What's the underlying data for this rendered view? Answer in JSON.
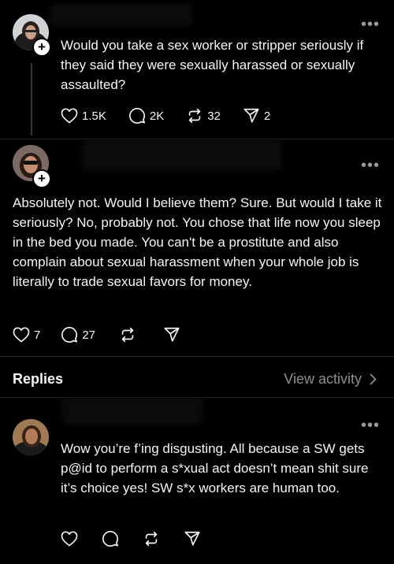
{
  "post": {
    "text": "Would you take a sex worker or stripper seriously if they said they were sexually harassed or sexually assaulted?",
    "likes": "1.5K",
    "comments": "2K",
    "reposts": "32",
    "shares": "2",
    "more": "•••"
  },
  "comment": {
    "text": "Absolutely not. Would I believe them? Sure. But would I take it seriously? No, probably not. You chose that life now you sleep in the bed you made.  You can't be a prostitute and also complain about sexual harassment when your whole job is literally to trade sexual favors for money.",
    "likes": "7",
    "comments": "27",
    "more": "•••"
  },
  "replies_header": {
    "title": "Replies",
    "view_activity": "View activity"
  },
  "reply": {
    "text": "Wow you’re f’ing disgusting. All because a SW gets p@id to perform a s*xual act doesn’t mean shit sure it’s choice yes! SW s*x workers are human too.",
    "more": "•••"
  },
  "colors": {
    "background": "#000000",
    "text": "#f3f5f7",
    "muted": "#8e8e8e",
    "divider": "#262626"
  }
}
